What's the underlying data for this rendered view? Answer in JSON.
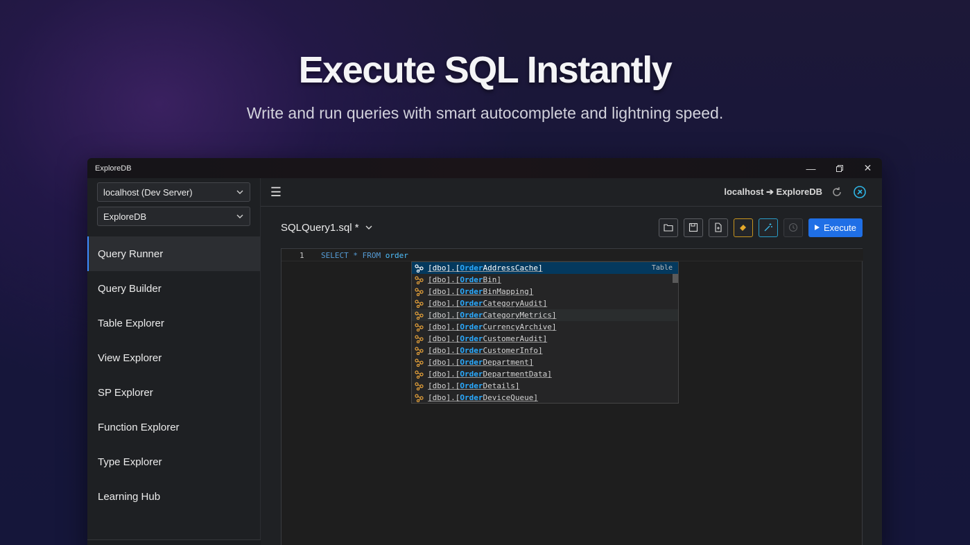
{
  "hero": {
    "title": "Execute SQL Instantly",
    "subtitle": "Write and run queries with smart autocomplete and lightning speed."
  },
  "window": {
    "title": "ExploreDB",
    "controls": [
      "minimize-icon",
      "restore-icon",
      "close-icon"
    ]
  },
  "sidebar": {
    "server_select": "localhost (Dev Server)",
    "database_select": "ExploreDB",
    "items": [
      {
        "label": "Query Runner",
        "active": true
      },
      {
        "label": "Query Builder"
      },
      {
        "label": "Table Explorer"
      },
      {
        "label": "View Explorer"
      },
      {
        "label": "SP Explorer"
      },
      {
        "label": "Function Explorer"
      },
      {
        "label": "Type Explorer"
      },
      {
        "label": "Learning Hub"
      }
    ]
  },
  "topbar": {
    "connection": "localhost ➔ ExploreDB"
  },
  "query": {
    "tab_name": "SQLQuery1.sql *",
    "execute_label": "Execute",
    "toolbar_icons": [
      "open-folder-icon",
      "save-icon",
      "export-file-icon",
      "eraser-icon",
      "magic-wand-icon",
      "history-icon"
    ]
  },
  "editor": {
    "line_number": "1",
    "code_keywords": "SELECT * FROM",
    "code_identifier": "order"
  },
  "autocomplete": {
    "kind_label": "Table",
    "prefix": "[dbo].[",
    "match": "Order",
    "items": [
      {
        "rest": "AddressCache]"
      },
      {
        "rest": "Bin]"
      },
      {
        "rest": "BinMapping]"
      },
      {
        "rest": "CategoryAudit]"
      },
      {
        "rest": "CategoryMetrics]"
      },
      {
        "rest": "CurrencyArchive]"
      },
      {
        "rest": "CustomerAudit]"
      },
      {
        "rest": "CustomerInfo]"
      },
      {
        "rest": "Department]"
      },
      {
        "rest": "DepartmentData]"
      },
      {
        "rest": "Details]"
      },
      {
        "rest": "DeviceQueue]"
      }
    ]
  },
  "colors": {
    "accent": "#1f6fe6",
    "active_border": "#3c8cff",
    "match_highlight": "#2aaaff",
    "table_icon": "#e8a33a"
  }
}
